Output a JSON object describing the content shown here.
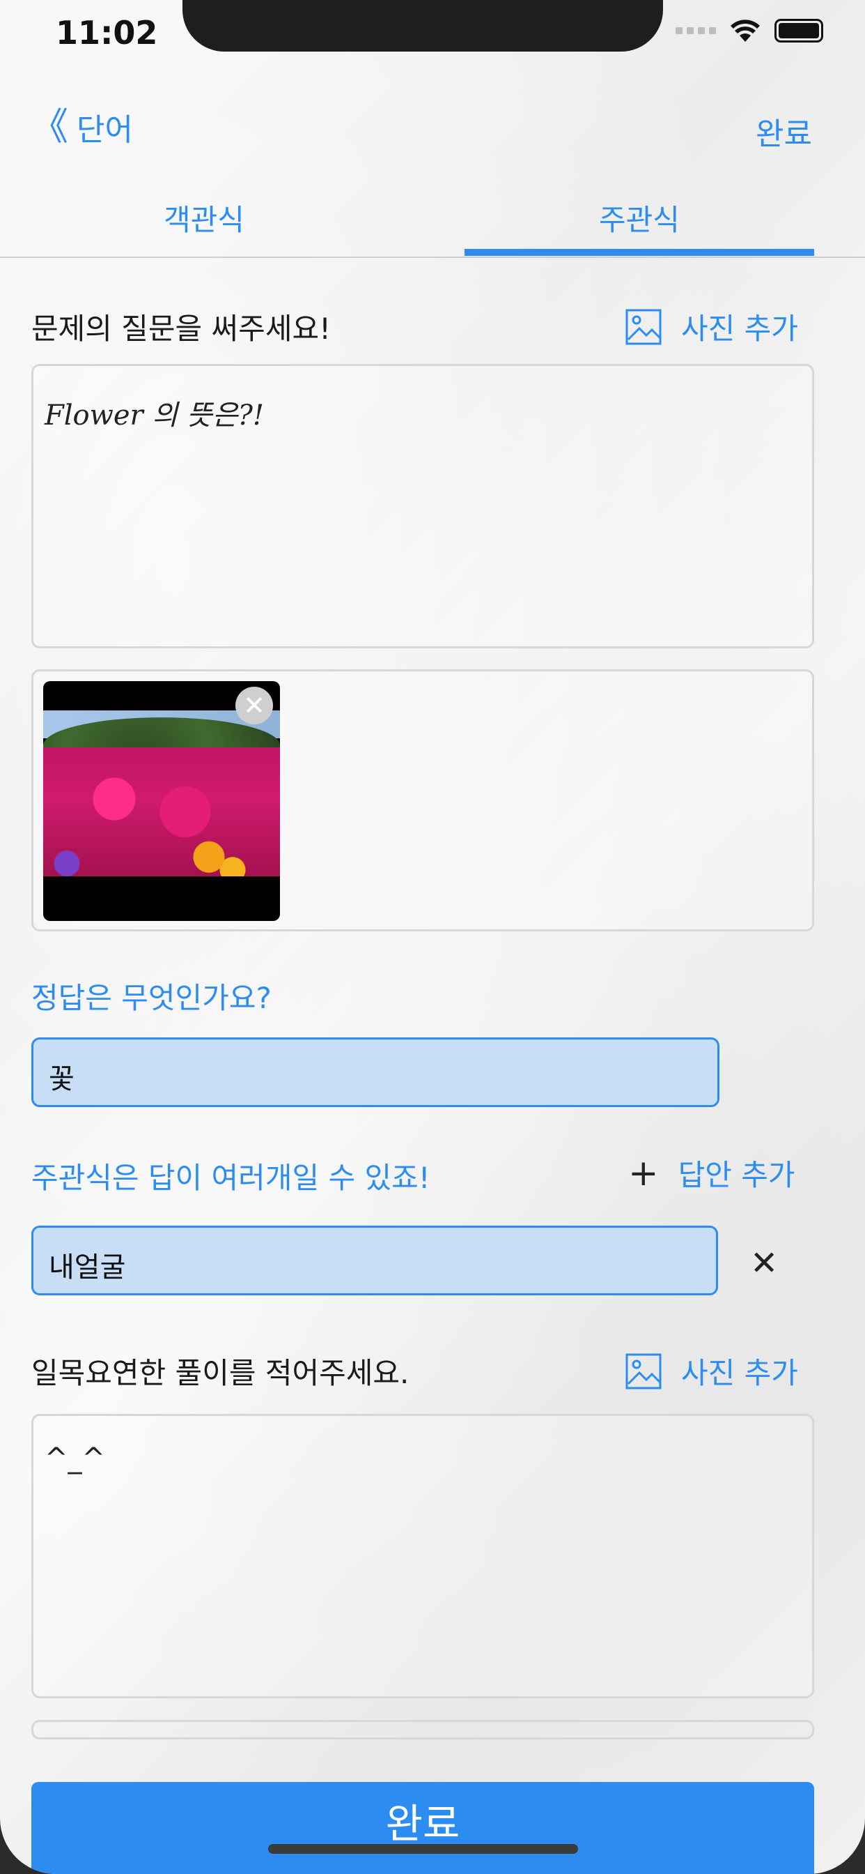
{
  "status": {
    "time": "11:02"
  },
  "nav": {
    "back_label": "단어",
    "back_chevron": "《",
    "done_label": "완료"
  },
  "tabs": [
    {
      "label": "객관식"
    },
    {
      "label": "주관식",
      "selected": true
    }
  ],
  "question": {
    "prompt": "문제의 질문을 써주세요!",
    "add_photo": "사진 추가",
    "text": "Flower 의 뜻은?!"
  },
  "answer": {
    "label": "정답은 무엇인가요?",
    "value": "꽃"
  },
  "alternatives": {
    "label": "주관식은 답이 여러개일 수 있죠!",
    "add_label": "답안 추가",
    "plus": "+",
    "items": [
      {
        "value": "내얼굴",
        "remove": "✕"
      }
    ]
  },
  "explanation": {
    "prompt": "일목요연한 풀이를 적어주세요.",
    "add_photo": "사진 추가",
    "text": "^_^"
  },
  "submit": {
    "label": "완료"
  },
  "icons": {
    "image_close": "✕"
  },
  "colors": {
    "accent": "#2c8cf0",
    "input_bg": "#c8def6"
  }
}
